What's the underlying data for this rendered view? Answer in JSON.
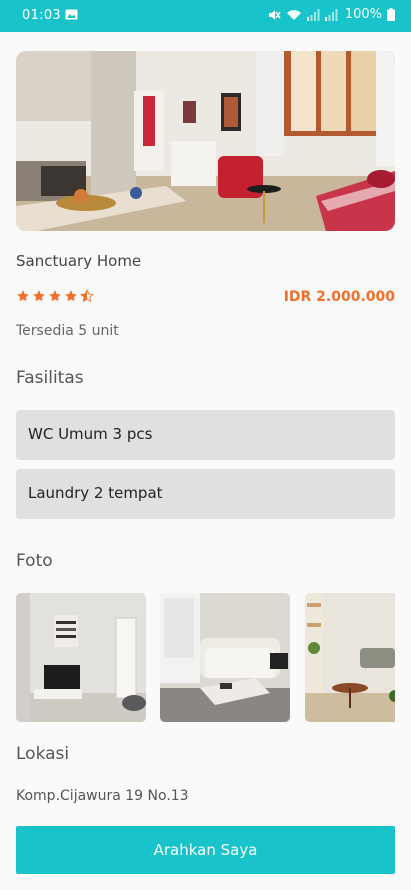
{
  "status_bar": {
    "time": "01:03",
    "battery": "100%",
    "icons": [
      "gallery-icon",
      "mute-icon",
      "wifi-icon",
      "signal-icon",
      "signal-icon",
      "battery-icon"
    ]
  },
  "hero": {
    "image": "living-room-photo"
  },
  "listing": {
    "title": "Sanctuary Home",
    "rating": 4.5,
    "rating_max": 5,
    "price": "IDR 2.000.000",
    "availability": "Tersedia 5 unit"
  },
  "facilities": {
    "title": "Fasilitas",
    "items": [
      {
        "label": "WC Umum 3 pcs"
      },
      {
        "label": "Laundry 2 tempat"
      }
    ]
  },
  "photos": {
    "title": "Foto",
    "items": [
      "bedroom-tv-photo",
      "living-room-sofa-photo",
      "dining-room-photo"
    ]
  },
  "location": {
    "title": "Lokasi",
    "address": "Komp.Cijawura 19 No.13"
  },
  "cta": {
    "label": "Arahkan Saya"
  },
  "colors": {
    "primary": "#18c3c9",
    "price": "#f0702a",
    "star": "#f0702a",
    "chip_bg": "#e0e0e0"
  }
}
